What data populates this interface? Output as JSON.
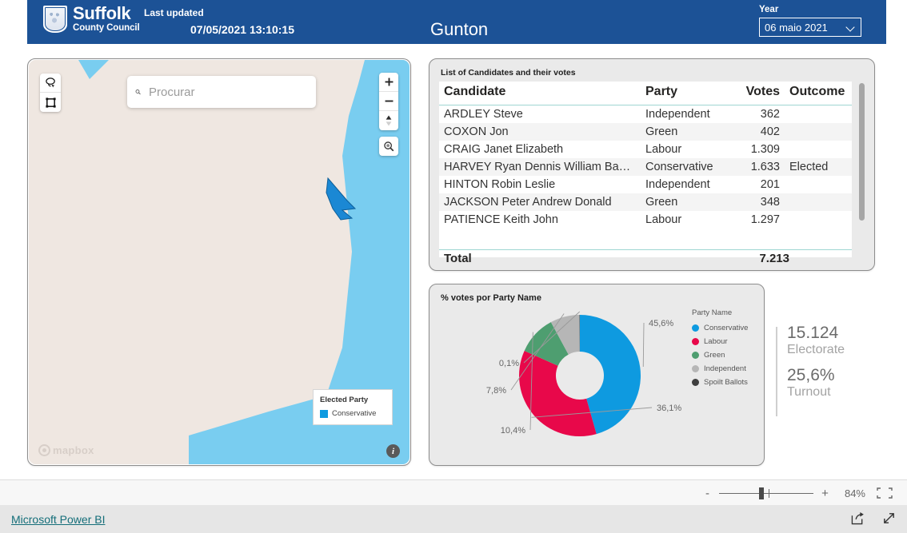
{
  "header": {
    "logo_line1": "Suffolk",
    "logo_line2": "County Council",
    "logo_icon": "suffolk-shield-icon",
    "last_updated_label": "Last updated",
    "last_updated_value": "07/05/2021 13:10:15",
    "page_title": "Gunton",
    "year_label": "Year",
    "year_value": "06 maio 2021",
    "background_color": "#1c5296"
  },
  "map": {
    "search_placeholder": "Procurar",
    "search_value": "",
    "search_icon": "search-icon",
    "tools": [
      {
        "name": "lasso-select-tool",
        "icon": "lasso-icon"
      },
      {
        "name": "box-select-tool",
        "icon": "box-select-icon"
      }
    ],
    "zoom_controls": [
      {
        "name": "zoom-in-button",
        "label": "+"
      },
      {
        "name": "zoom-out-button",
        "label": "−"
      },
      {
        "name": "compass-button",
        "label": "compass-icon"
      }
    ],
    "find_button_icon": "magnifier-icon",
    "legend": {
      "title": "Elected Party",
      "items": [
        {
          "label": "Conservative",
          "color": "#0e9ae0"
        }
      ]
    },
    "attribution": "mapbox",
    "info_button": "i",
    "land_color": "#efe7e1",
    "water_color": "#79cdf0",
    "ward_color": "#1b88d4"
  },
  "table": {
    "title": "List of Candidates and their votes",
    "columns": [
      "Candidate",
      "Party",
      "Votes",
      "Outcome"
    ],
    "rows": [
      {
        "candidate": "ARDLEY Steve",
        "party": "Independent",
        "votes": "362",
        "outcome": ""
      },
      {
        "candidate": "COXON Jon",
        "party": "Green",
        "votes": "402",
        "outcome": ""
      },
      {
        "candidate": "CRAIG Janet Elizabeth",
        "party": "Labour",
        "votes": "1.309",
        "outcome": ""
      },
      {
        "candidate": "HARVEY Ryan Dennis William Banks",
        "party": "Conservative",
        "votes": "1.633",
        "outcome": "Elected"
      },
      {
        "candidate": "HINTON Robin Leslie",
        "party": "Independent",
        "votes": "201",
        "outcome": ""
      },
      {
        "candidate": "JACKSON Peter Andrew Donald",
        "party": "Green",
        "votes": "348",
        "outcome": ""
      },
      {
        "candidate": "PATIENCE Keith John",
        "party": "Labour",
        "votes": "1.297",
        "outcome": ""
      }
    ],
    "total_label": "Total",
    "total_votes": "7.213"
  },
  "pie": {
    "title": "% votes por Party Name",
    "legend_title": "Party Name"
  },
  "chart_data": {
    "type": "pie",
    "title": "% votes por Party Name",
    "legend_title": "Party Name",
    "legend_position": "right",
    "donut": true,
    "categories": [
      "Conservative",
      "Labour",
      "Green",
      "Independent",
      "Spoilt Ballots"
    ],
    "values": [
      45.6,
      36.1,
      10.4,
      7.8,
      0.1
    ],
    "labels": [
      "45,6%",
      "36,1%",
      "10,4%",
      "7,8%",
      "0,1%"
    ],
    "colors": [
      "#0e9ae0",
      "#e8084a",
      "#4e9e70",
      "#b6b6b6",
      "#3f3f3f"
    ],
    "xlabel": "",
    "ylabel": ""
  },
  "kpis": [
    {
      "value": "15.124",
      "label": "Electorate"
    },
    {
      "value": "25,6%",
      "label": "Turnout"
    }
  ],
  "statusbar": {
    "zoom_minus": "-",
    "zoom_plus": "+",
    "zoom_percent": "84%",
    "fit_to_page_icon": "fit-to-page-icon"
  },
  "footer": {
    "powerbi_link": "Microsoft Power BI",
    "share_icon": "share-icon",
    "fullscreen_icon": "fullscreen-icon"
  }
}
